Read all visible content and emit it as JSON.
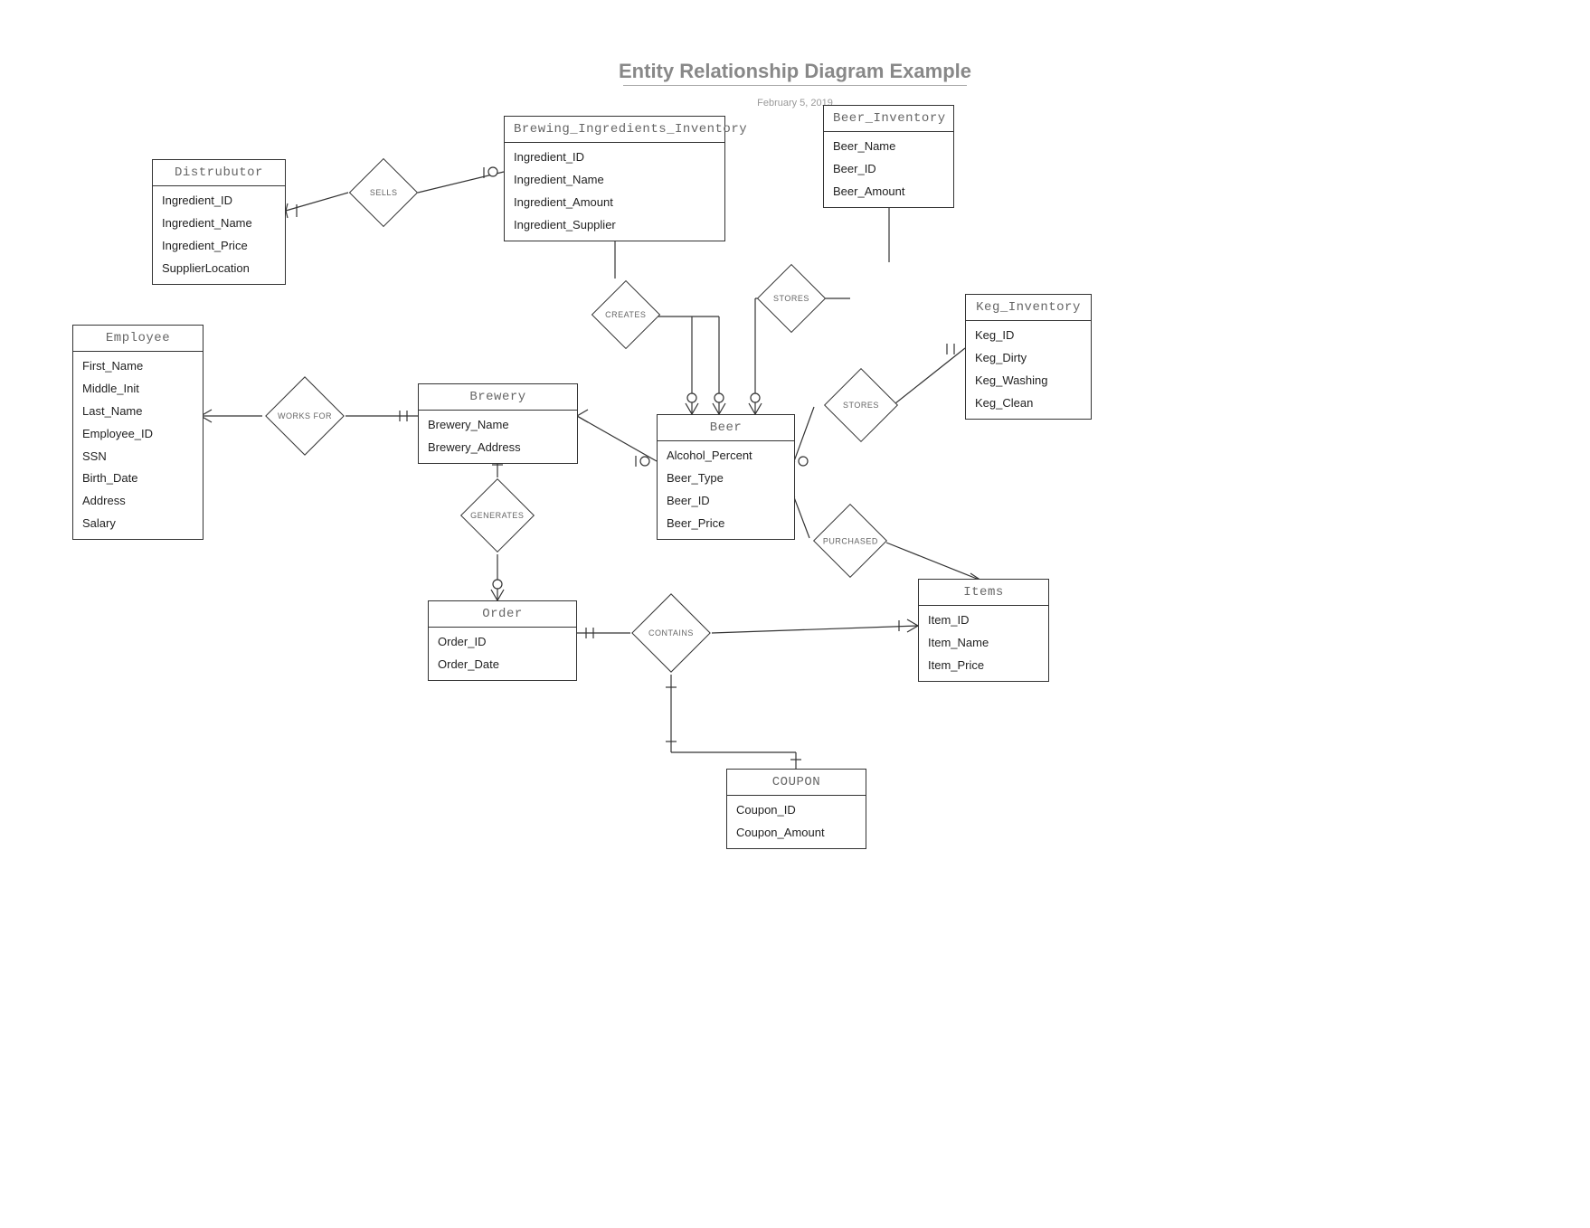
{
  "title": "Entity Relationship Diagram Example",
  "date": "February 5, 2019",
  "entities": {
    "distributor": {
      "name": "Distrubutor",
      "attrs": [
        "Ingredient_ID",
        "Ingredient_Name",
        "Ingredient_Price",
        "SupplierLocation"
      ]
    },
    "brewing_ingredients": {
      "name": "Brewing_Ingredients_Inventory",
      "attrs": [
        "Ingredient_ID",
        "Ingredient_Name",
        "Ingredient_Amount",
        "Ingredient_Supplier"
      ]
    },
    "beer_inventory": {
      "name": "Beer_Inventory",
      "attrs": [
        "Beer_Name",
        "Beer_ID",
        "Beer_Amount"
      ]
    },
    "employee": {
      "name": "Employee",
      "attrs": [
        "First_Name",
        "Middle_Init",
        "Last_Name",
        "Employee_ID",
        "SSN",
        "Birth_Date",
        "Address",
        "Salary"
      ]
    },
    "brewery": {
      "name": "Brewery",
      "attrs": [
        "Brewery_Name",
        "Brewery_Address"
      ]
    },
    "keg_inventory": {
      "name": "Keg_Inventory",
      "attrs": [
        "Keg_ID",
        "Keg_Dirty",
        "Keg_Washing",
        "Keg_Clean"
      ]
    },
    "beer": {
      "name": "Beer",
      "attrs": [
        "Alcohol_Percent",
        "Beer_Type",
        "Beer_ID",
        "Beer_Price"
      ]
    },
    "order": {
      "name": "Order",
      "attrs": [
        "Order_ID",
        "Order_Date"
      ]
    },
    "items": {
      "name": "Items",
      "attrs": [
        "Item_ID",
        "Item_Name",
        "Item_Price"
      ]
    },
    "coupon": {
      "name": "COUPON",
      "attrs": [
        "Coupon_ID",
        "Coupon_Amount"
      ]
    }
  },
  "relationships": {
    "sells": "SELLS",
    "creates": "CREATES",
    "stores1": "STORES",
    "stores2": "STORES",
    "works_for": "WORKS FOR",
    "generates": "GENERATES",
    "purchased": "PURCHASED",
    "contains": "CONTAINS"
  }
}
